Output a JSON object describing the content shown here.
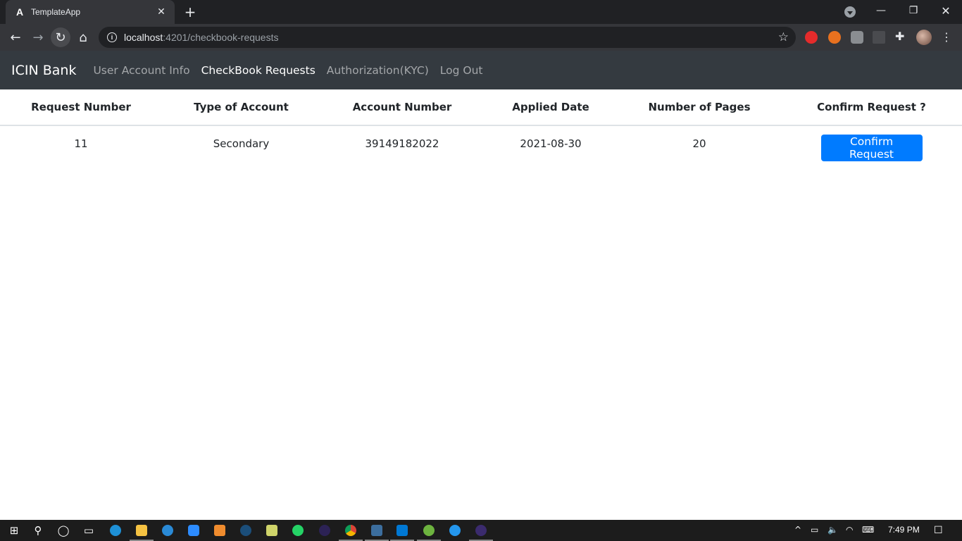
{
  "browser": {
    "tab_title": "TemplateApp",
    "tab_favicon": "A",
    "url_host": "localhost",
    "url_path": ":4201/checkbook-requests"
  },
  "app": {
    "brand": "ICIN Bank",
    "nav": [
      {
        "label": "User Account Info",
        "active": false
      },
      {
        "label": "CheckBook Requests",
        "active": true
      },
      {
        "label": "Authorization(KYC)",
        "active": false
      },
      {
        "label": "Log Out",
        "active": false
      }
    ]
  },
  "table": {
    "headers": [
      "Request Number",
      "Type of Account",
      "Account Number",
      "Applied Date",
      "Number of Pages",
      "Confirm Request ?"
    ],
    "rows": [
      {
        "request_number": "11",
        "account_type": "Secondary",
        "account_number": "39149182022",
        "applied_date": "2021-08-30",
        "pages": "20",
        "action_label": "Confirm Request"
      }
    ]
  },
  "taskbar": {
    "time": "7:49 PM"
  },
  "colors": {
    "navbar_bg": "#343a40",
    "primary": "#007bff",
    "chrome_dark": "#202124"
  }
}
